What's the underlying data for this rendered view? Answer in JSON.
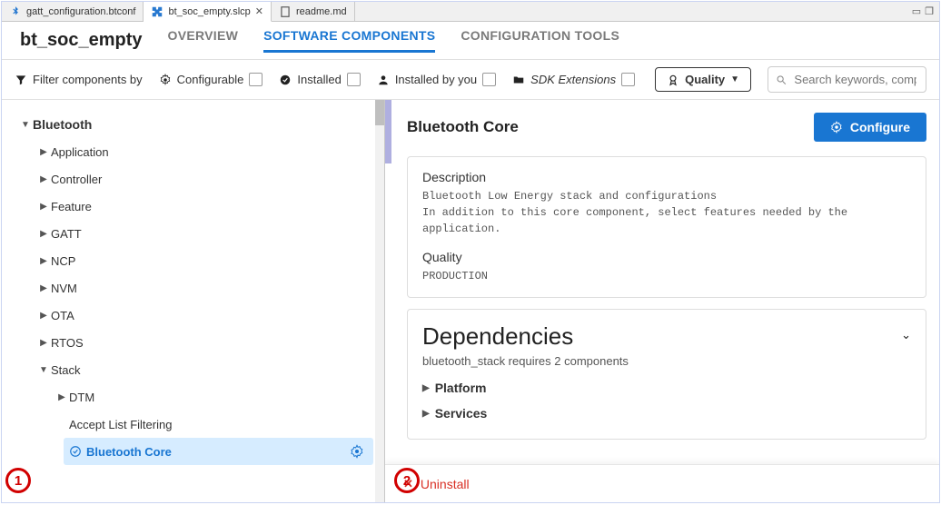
{
  "tabs": {
    "file_tabs": [
      {
        "icon": "bluetooth-icon",
        "label": "gatt_configuration.btconf",
        "closable": false,
        "active": false
      },
      {
        "icon": "puzzle-icon",
        "label": "bt_soc_empty.slcp",
        "closable": true,
        "active": true
      },
      {
        "icon": "doc-icon",
        "label": "readme.md",
        "closable": false,
        "active": false
      }
    ]
  },
  "header": {
    "project_title": "bt_soc_empty",
    "main_tabs": [
      {
        "id": "overview",
        "label": "OVERVIEW",
        "active": false
      },
      {
        "id": "sw",
        "label": "SOFTWARE COMPONENTS",
        "active": true
      },
      {
        "id": "cfg",
        "label": "CONFIGURATION TOOLS",
        "active": false
      }
    ]
  },
  "filter": {
    "filter_label": "Filter components by",
    "items": [
      {
        "icon": "gear-icon",
        "label": "Configurable"
      },
      {
        "icon": "check-circle-icon",
        "label": "Installed"
      },
      {
        "icon": "user-icon",
        "label": "Installed by you"
      },
      {
        "icon": "folder-icon",
        "label": "SDK Extensions",
        "italic": true
      }
    ],
    "quality": {
      "icon": "ribbon-icon",
      "label": "Quality"
    },
    "search": {
      "placeholder": "Search keywords, component'..."
    }
  },
  "tree": {
    "root": {
      "label": "Bluetooth",
      "expanded": true
    },
    "children": [
      {
        "label": "Application",
        "expanded": false
      },
      {
        "label": "Controller",
        "expanded": false
      },
      {
        "label": "Feature",
        "expanded": false
      },
      {
        "label": "GATT",
        "expanded": false
      },
      {
        "label": "NCP",
        "expanded": false
      },
      {
        "label": "NVM",
        "expanded": false
      },
      {
        "label": "OTA",
        "expanded": false
      },
      {
        "label": "RTOS",
        "expanded": false
      }
    ],
    "stack": {
      "label": "Stack",
      "expanded": true
    },
    "stack_children": [
      {
        "label": "DTM",
        "expanded": false,
        "indent": 1,
        "caret": true
      },
      {
        "label": "Accept List Filtering",
        "indent": 1,
        "caret": false
      },
      {
        "label": "Bluetooth Core",
        "indent": 1,
        "caret": false,
        "selected": true,
        "check": true,
        "gear": true
      }
    ]
  },
  "detail": {
    "title": "Bluetooth Core",
    "configure_label": "Configure",
    "description": {
      "label": "Description",
      "line1": "Bluetooth Low Energy stack and configurations",
      "line2": "In addition to this core component, select features needed by the application."
    },
    "quality": {
      "label": "Quality",
      "value": "PRODUCTION"
    },
    "dependencies": {
      "title": "Dependencies",
      "subtitle": "bluetooth_stack requires 2 components",
      "items": [
        {
          "label": "Platform"
        },
        {
          "label": "Services"
        }
      ]
    },
    "uninstall_label": "Uninstall"
  },
  "annotations": {
    "a1": "1",
    "a2": "2"
  }
}
